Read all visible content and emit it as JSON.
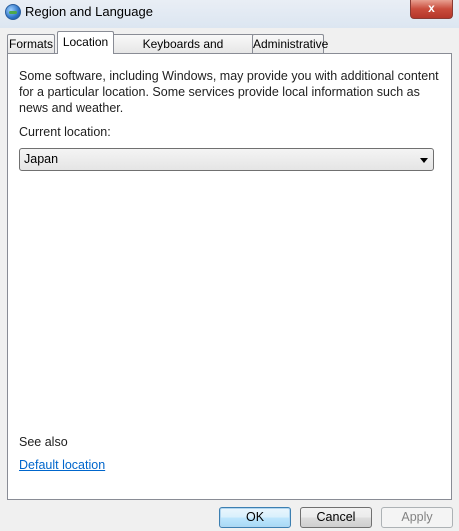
{
  "window": {
    "title": "Region and Language",
    "close_label": "x"
  },
  "tabs": [
    {
      "label": "Formats",
      "active": false
    },
    {
      "label": "Location",
      "active": true
    },
    {
      "label": "Keyboards and Languages",
      "active": false
    },
    {
      "label": "Administrative",
      "active": false
    }
  ],
  "location": {
    "description": "Some software, including Windows, may provide you with additional content for a particular location. Some services provide local information such as news and weather.",
    "current_label": "Current location:",
    "current_value": "Japan"
  },
  "see_also": {
    "heading": "See also",
    "link_label": "Default location"
  },
  "buttons": {
    "ok": "OK",
    "cancel": "Cancel",
    "apply": "Apply"
  }
}
